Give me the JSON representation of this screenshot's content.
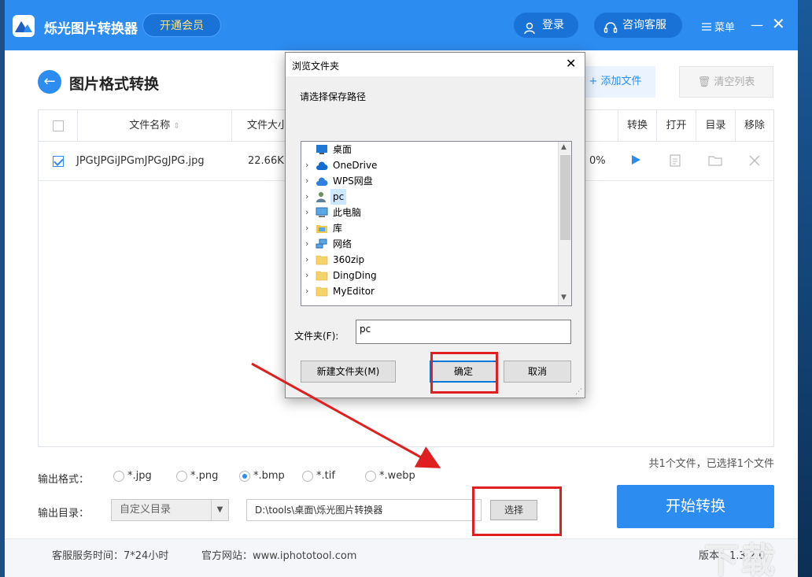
{
  "app": {
    "title": "烁光图片转换器",
    "vip_label": "开通会员",
    "login_label": "登录",
    "service_label": "咨询客服",
    "menu_label": "菜单"
  },
  "page": {
    "title": "图片格式转换",
    "add_file_label": "添加文件",
    "clear_list_label": "清空列表"
  },
  "table": {
    "columns": [
      "文件名称",
      "文件大小",
      "转换",
      "打开",
      "目录",
      "移除"
    ],
    "rows": [
      {
        "name": "JPGtJPGiJPGmJPGgJPG.jpg",
        "size": "22.66KB",
        "progress": "0%",
        "checked": true
      }
    ]
  },
  "summary": "共1个文件，已选择1个文件",
  "output": {
    "format_label": "输出格式：",
    "formats": [
      "*.jpg",
      "*.png",
      "*.bmp",
      "*.tif",
      "*.webp"
    ],
    "selected_format": "*.bmp",
    "dir_label": "输出目录：",
    "dir_mode": "自定义目录",
    "path": "D:\\tools\\桌面\\烁光图片转换器",
    "select_label": "选择"
  },
  "start_label": "开始转换",
  "footer": {
    "service_time": "客服服务时间：7*24小时",
    "website": "官方网站：www.iphototool.com",
    "version": "版本：1.3.2.0"
  },
  "watermark": "下载",
  "dialog": {
    "title": "浏览文件夹",
    "prompt": "请选择保存路径",
    "tree": [
      {
        "label": "桌面",
        "icon": "desktop-icon",
        "expandable": false
      },
      {
        "label": "OneDrive",
        "icon": "cloud-icon",
        "expandable": true
      },
      {
        "label": "WPS网盘",
        "icon": "cloud-icon",
        "expandable": true
      },
      {
        "label": "pc",
        "icon": "user-icon",
        "expandable": true,
        "selected": true
      },
      {
        "label": "此电脑",
        "icon": "computer-icon",
        "expandable": true
      },
      {
        "label": "库",
        "icon": "library-icon",
        "expandable": true
      },
      {
        "label": "网络",
        "icon": "network-icon",
        "expandable": true
      },
      {
        "label": "360zip",
        "icon": "folder-icon",
        "expandable": true
      },
      {
        "label": "DingDing",
        "icon": "folder-icon",
        "expandable": true
      },
      {
        "label": "MyEditor",
        "icon": "folder-icon",
        "expandable": true
      }
    ],
    "folder_label": "文件夹(F):",
    "folder_value": "pc",
    "new_folder_label": "新建文件夹(M)",
    "ok_label": "确定",
    "cancel_label": "取消"
  },
  "colors": {
    "brand": "#2d8cf0",
    "annotation": "#e02020"
  }
}
